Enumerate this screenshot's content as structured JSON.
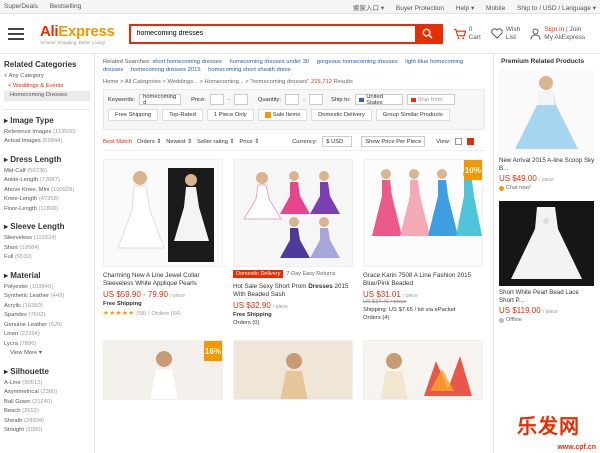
{
  "topbar": {
    "left": [
      "SuperDeals",
      "Bestselling"
    ],
    "right": [
      "索家入口 ▾",
      "Buyer Protection",
      "Help ▾",
      "Mobile",
      "Ship to",
      "/ USD / Language ▾"
    ]
  },
  "header": {
    "brand_a": "Ali",
    "brand_b": "Express",
    "tagline": "Smarter Shopping, Better Living!",
    "search_value": "homecoming dresses",
    "cart_count": "0",
    "cart_label": "Cart",
    "wish_label_1": "Wish",
    "wish_label_2": "List",
    "signin_1": "Sign in",
    "join": "| Join",
    "my_ae": "My AliExpress"
  },
  "left": {
    "related_title": "Related Categories",
    "any": "< Any Category",
    "cat1": "< Weddings & Events",
    "cat2": "Homecoming Dresses",
    "image_type": {
      "title": "Image Type",
      "items": [
        [
          "Reference Images",
          "(113500)"
        ],
        [
          "Actual Images",
          "(69844)"
        ]
      ]
    },
    "dress_length": {
      "title": "Dress Length",
      "items": [
        [
          "Mid-Calf",
          "(50736)"
        ],
        [
          "Ankle-Length",
          "(72087)"
        ],
        [
          "Above Knee, Mini",
          "(100929)"
        ],
        [
          "Knee-Length",
          "(47258)"
        ],
        [
          "Floor-Length",
          "(11800)"
        ]
      ]
    },
    "sleeve_length": {
      "title": "Sleeve Length",
      "items": [
        [
          "Sleeveless",
          "(119224)"
        ],
        [
          "Short",
          "(19584)"
        ],
        [
          "Full",
          "(6532)"
        ]
      ]
    },
    "material": {
      "title": "Material",
      "items": [
        [
          "Polyester",
          "(103849)"
        ],
        [
          "Synthetic Leather",
          "(449)"
        ],
        [
          "Acrylic",
          "(16350)"
        ],
        [
          "Spandex",
          "(7692)"
        ],
        [
          "Genuine Leather",
          "(526)"
        ],
        [
          "Linen",
          "(22294)"
        ],
        [
          "Lycra",
          "(7896)"
        ]
      ],
      "more": "View More ▾"
    },
    "silhouette": {
      "title": "Silhouette",
      "items": [
        [
          "A-Line",
          "(90512)"
        ],
        [
          "Asymmetrical",
          "(2380)"
        ],
        [
          "Ball Gown",
          "(21240)"
        ],
        [
          "Beach",
          "(2652)"
        ],
        [
          "Sheath",
          "(24904)"
        ],
        [
          "Straight",
          "(2060)"
        ]
      ]
    }
  },
  "main": {
    "related_label": "Related Searches:",
    "related_links": [
      "short homecoming dresses",
      "homecoming dresses under 30",
      "gorgeous homecoming dresses",
      "light blue homecoming dresses",
      "homecoming dresses 2015",
      "homecoming short sheath dress"
    ],
    "crumb": "Home > All Categories > Weddings... > Homecoming... > \"homecoming dresses\"",
    "results_count": "215,712",
    "results_label": "Results",
    "filters": {
      "keywords_label": "Keywords:",
      "keywords_value": "homecoming d",
      "price_label": "Price:",
      "quantity_label": "Quantity:",
      "ship_to_label": "Ship to:",
      "ship_to_value": "United States",
      "ship_from": "Ship from",
      "chips": [
        "Free Shipping",
        "Top-Rated",
        "1 Piece Only",
        "Sale Items",
        "Domestic Delivery",
        "Group Similar Products"
      ]
    },
    "sort": {
      "best": "Best Match",
      "orders": "Orders ⇕",
      "newest": "Newest ⇕",
      "seller": "Seller rating ⇕",
      "price": "Price ⇕",
      "currency_label": "Currency:",
      "currency": "$ USD",
      "show_price": "Show Price Per Piece",
      "view": "View:"
    },
    "products": [
      {
        "title_a": "Charming New A Line Jewel Collar Sleeveless White Applique Pearls",
        "title_b": "",
        "price": "US $59.90 - 79.90",
        "unit": "/ piece",
        "ship": "Free Shipping",
        "rating": "(58)",
        "orders": "| Orders (64)",
        "badge": ""
      },
      {
        "title_a": "Hot Sale Sexy Short Prom ",
        "title_b": "Dresses",
        "title_c": " 2015 With Beaded Sash",
        "price": "US $32.90",
        "unit": "/ piece",
        "ship": "Free Shipping",
        "orders": "Orders (0)",
        "promo": "Domestic Delivery",
        "promo_sub": "7-Day Easy Returns",
        "badge": ""
      },
      {
        "title_a": "Grace Karin 7508 A Line Fashion 2015 Blue/Pink Beaded",
        "title_b": "",
        "price": "US $31.01",
        "unit": "/ piece",
        "old": "US $34.46 / piece",
        "ship": "Shipping: US $7.65 / lot via ePacket",
        "orders": "Orders (4)",
        "badge": "10%"
      }
    ],
    "row2_badge": "16%"
  },
  "right": {
    "title": "Premium Related Products",
    "items": [
      {
        "title": "New Arrival 2015 A-line Scoop Sky B...",
        "price": "US $49.00",
        "unit": "/ piece",
        "chat": "Chat now!"
      },
      {
        "title": "Short White Pearl Bead Lace Short P...",
        "price": "US $119.00",
        "unit": "/ piece",
        "chat": "Offline"
      }
    ]
  },
  "watermark": {
    "big": "乐发网",
    "small": "www.cpf.cn"
  }
}
